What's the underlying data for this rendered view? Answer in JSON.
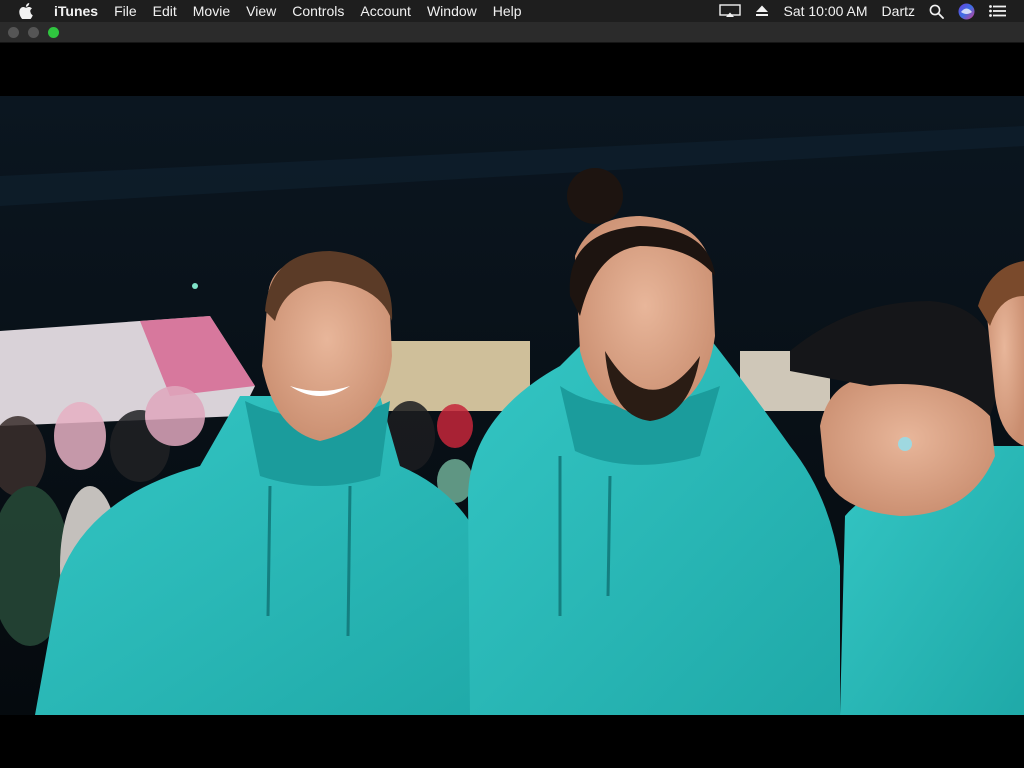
{
  "menubar": {
    "app_name": "iTunes",
    "menus": [
      "File",
      "Edit",
      "Movie",
      "View",
      "Controls",
      "Account",
      "Window",
      "Help"
    ],
    "clock": "Sat 10:00 AM",
    "user": "Dartz",
    "status_icons": [
      "airplay-display-icon",
      "eject-icon",
      "search-icon",
      "siri-icon",
      "notification-center-icon"
    ]
  },
  "window": {
    "zoom_color": "#2fc53f"
  }
}
